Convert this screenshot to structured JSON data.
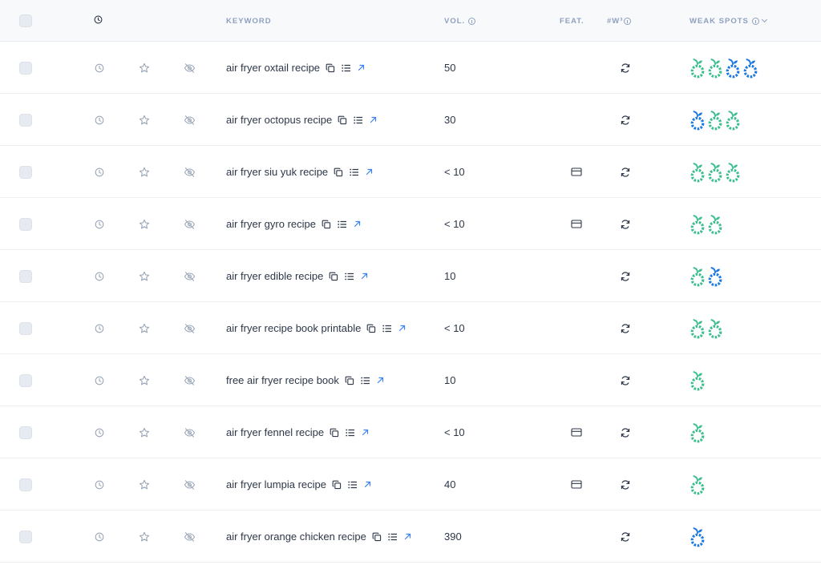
{
  "colors": {
    "spot_green": "#3ebf8f",
    "spot_blue": "#1f7ae0",
    "link_blue": "#3b82f6",
    "header_text": "#8ea0c0"
  },
  "header": {
    "history_icon": "clock-icon",
    "keyword": "KEYWORD",
    "volume": "VOL.",
    "features": "FEAT.",
    "w3": "#W³",
    "weak_spots": "WEAK SPOTS"
  },
  "row_icons": [
    "clock-icon",
    "star-icon",
    "eye-off-icon",
    "copy-icon",
    "list-icon",
    "external-link-icon",
    "refresh-icon",
    "card-icon"
  ],
  "rows": [
    {
      "keyword": "air fryer oxtail recipe",
      "volume": "50",
      "feature": false,
      "spots": [
        "green",
        "green",
        "blue",
        "blue"
      ]
    },
    {
      "keyword": "air fryer octopus recipe",
      "volume": "30",
      "feature": false,
      "spots": [
        "blue",
        "green",
        "green"
      ]
    },
    {
      "keyword": "air fryer siu yuk recipe",
      "volume": "< 10",
      "feature": true,
      "spots": [
        "green",
        "green",
        "green"
      ]
    },
    {
      "keyword": "air fryer gyro recipe",
      "volume": "< 10",
      "feature": true,
      "spots": [
        "green",
        "green"
      ]
    },
    {
      "keyword": "air fryer edible recipe",
      "volume": "10",
      "feature": false,
      "spots": [
        "green",
        "blue"
      ]
    },
    {
      "keyword": "air fryer recipe book printable",
      "volume": "< 10",
      "feature": false,
      "spots": [
        "green",
        "green"
      ]
    },
    {
      "keyword": "free air fryer recipe book",
      "volume": "10",
      "feature": false,
      "spots": [
        "green"
      ]
    },
    {
      "keyword": "air fryer fennel recipe",
      "volume": "< 10",
      "feature": true,
      "spots": [
        "green"
      ]
    },
    {
      "keyword": "air fryer lumpia recipe",
      "volume": "40",
      "feature": true,
      "spots": [
        "green"
      ]
    },
    {
      "keyword": "air fryer orange chicken recipe",
      "volume": "390",
      "feature": false,
      "spots": [
        "blue"
      ]
    }
  ]
}
